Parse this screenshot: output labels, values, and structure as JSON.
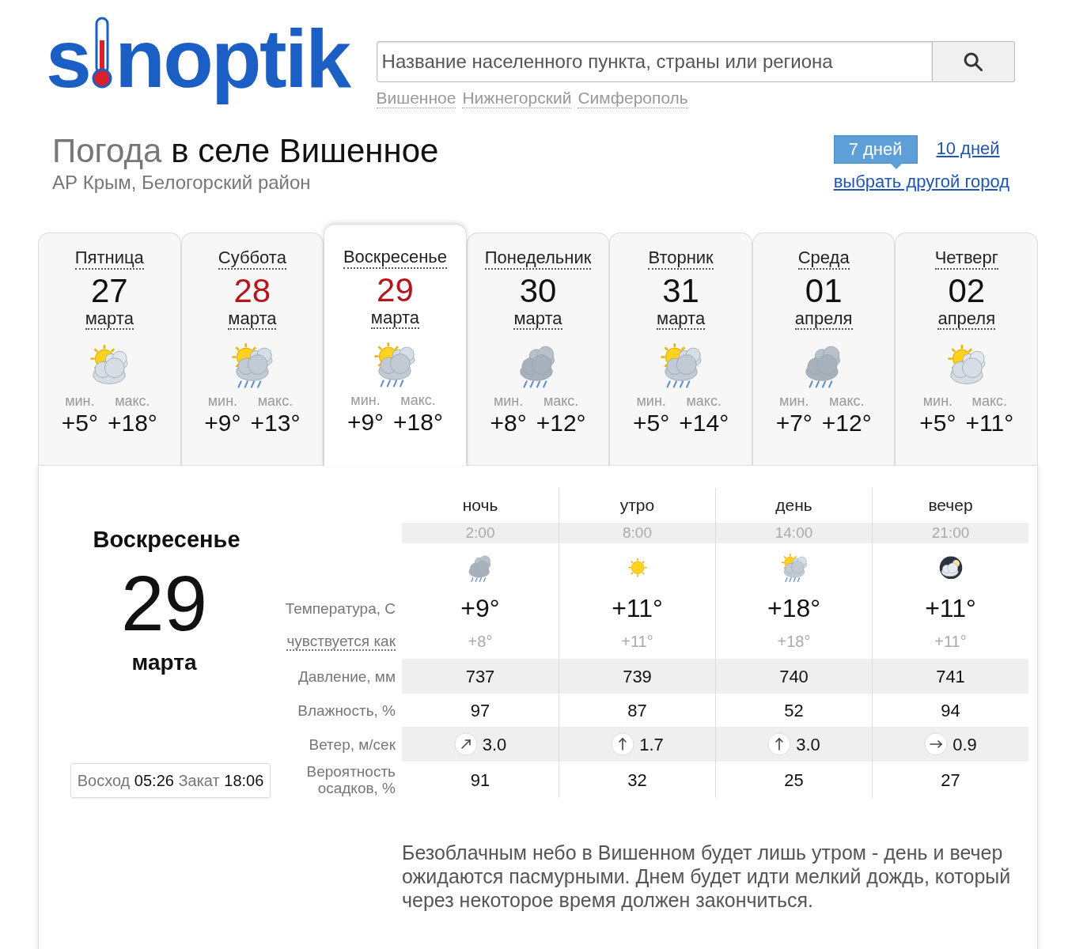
{
  "logo": {
    "before": "s",
    "after": "noptik"
  },
  "search": {
    "placeholder": "Название населенного пункта, страны или региона",
    "suggestions": [
      "Вишенное",
      "Нижнегорский",
      "Симферополь"
    ]
  },
  "heading": {
    "lead": "Погода",
    "rest": "в селе Вишенное",
    "subtitle": "АР Крым, Белогорский район"
  },
  "range_tabs": [
    {
      "label": "7 дней",
      "selected": true
    },
    {
      "label": "10 дней",
      "selected": false
    }
  ],
  "other_city_link": "выбрать другой город",
  "days": [
    {
      "weekday": "Пятница",
      "date": "27",
      "month": "марта",
      "weekend": false,
      "selected": false,
      "kind": "sun_cloud",
      "min_label": "мин.",
      "min": "+5°",
      "max_label": "макс.",
      "max": "+18°"
    },
    {
      "weekday": "Суббота",
      "date": "28",
      "month": "марта",
      "weekend": true,
      "selected": false,
      "kind": "sun_cloud_rain",
      "min_label": "мин.",
      "min": "+9°",
      "max_label": "макс.",
      "max": "+13°"
    },
    {
      "weekday": "Воскресенье",
      "date": "29",
      "month": "марта",
      "weekend": true,
      "selected": true,
      "kind": "sun_cloud_rain",
      "min_label": "мин.",
      "min": "+9°",
      "max_label": "макс.",
      "max": "+18°"
    },
    {
      "weekday": "Понедельник",
      "date": "30",
      "month": "марта",
      "weekend": false,
      "selected": false,
      "kind": "cloud_rain",
      "min_label": "мин.",
      "min": "+8°",
      "max_label": "макс.",
      "max": "+12°"
    },
    {
      "weekday": "Вторник",
      "date": "31",
      "month": "марта",
      "weekend": false,
      "selected": false,
      "kind": "sun_cloud_rain",
      "min_label": "мин.",
      "min": "+5°",
      "max_label": "макс.",
      "max": "+14°"
    },
    {
      "weekday": "Среда",
      "date": "01",
      "month": "апреля",
      "weekend": false,
      "selected": false,
      "kind": "cloud_rain",
      "min_label": "мин.",
      "min": "+7°",
      "max_label": "макс.",
      "max": "+12°"
    },
    {
      "weekday": "Четверг",
      "date": "02",
      "month": "апреля",
      "weekend": false,
      "selected": false,
      "kind": "sun_cloud",
      "min_label": "мин.",
      "min": "+5°",
      "max_label": "макс.",
      "max": "+11°"
    }
  ],
  "detail": {
    "weekday": "Воскресенье",
    "date": "29",
    "month": "марта",
    "sun": {
      "sunrise_label": "Восход",
      "sunrise": "05:26",
      "sunset_label": "Закат",
      "sunset": "18:06"
    },
    "row_labels": {
      "temperature": "Температура, С",
      "feels_like": "чувствуется как",
      "pressure": "Давление, мм",
      "humidity": "Влажность, %",
      "wind": "Ветер, м/сек",
      "precipitation": "Вероятность осадков, %"
    },
    "periods": [
      {
        "name": "ночь",
        "time": "2:00",
        "kind": "cloud_rain",
        "temperature": "+9°",
        "feels_like": "+8°",
        "pressure": "737",
        "humidity": "97",
        "wind": {
          "kind": "ne",
          "speed": "3.0"
        },
        "precipitation": "91"
      },
      {
        "name": "утро",
        "time": "8:00",
        "kind": "sun",
        "temperature": "+11°",
        "feels_like": "+11°",
        "pressure": "739",
        "humidity": "87",
        "wind": {
          "kind": "n",
          "speed": "1.7"
        },
        "precipitation": "32"
      },
      {
        "name": "день",
        "time": "14:00",
        "kind": "sun_cloud_rain",
        "temperature": "+18°",
        "feels_like": "+18°",
        "pressure": "740",
        "humidity": "52",
        "wind": {
          "kind": "n",
          "speed": "3.0"
        },
        "precipitation": "25"
      },
      {
        "name": "вечер",
        "time": "21:00",
        "kind": "moon_cloud",
        "temperature": "+11°",
        "feels_like": "+11°",
        "pressure": "741",
        "humidity": "94",
        "wind": {
          "kind": "e",
          "speed": "0.9"
        },
        "precipitation": "27"
      }
    ],
    "description": "Безоблачным небо в Вишенном будет лишь утром - день и вечер ожидаются пасмурными. Днем будет идти мелкий дождь, который через некоторое время должен закончиться."
  }
}
